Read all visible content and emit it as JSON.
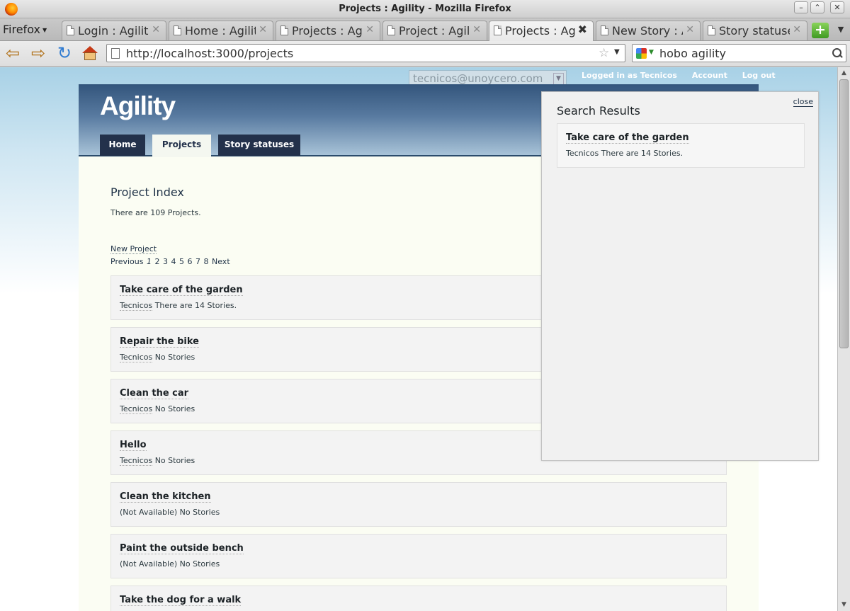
{
  "window": {
    "title": "Projects : Agility - Mozilla Firefox",
    "minimize": "–",
    "maximize": "⌃",
    "close": "✕"
  },
  "browser": {
    "menu_label": "Firefox",
    "tabs": [
      {
        "label": "Login : Agility"
      },
      {
        "label": "Home : Agility"
      },
      {
        "label": "Projects : Agility"
      },
      {
        "label": "Project : Agility"
      },
      {
        "label": "Projects : Agility"
      },
      {
        "label": "New Story : Agility"
      },
      {
        "label": "Story statuses : Agility"
      }
    ],
    "active_tab_index": 4,
    "url": "http://localhost:3000/projects",
    "search_query": "hobo agility",
    "search_engine_icon": "google-icon"
  },
  "site": {
    "user_select_value": "tecnicos@unoycero.com",
    "logged_in_text": "Logged in as Tecnicos",
    "account_link": "Account",
    "logout_link": "Log out",
    "app_name": "Agility",
    "nav": [
      {
        "label": "Home"
      },
      {
        "label": "Projects"
      },
      {
        "label": "Story statuses"
      }
    ],
    "current_nav_index": 1
  },
  "main": {
    "page_title": "Project Index",
    "count_text": "There are 109 Projects.",
    "new_link": "New Project",
    "pagination": {
      "previous": "Previous",
      "pages": [
        "1",
        "2",
        "3",
        "4",
        "5",
        "6",
        "7",
        "8"
      ],
      "current_page": "1",
      "next": "Next"
    },
    "projects": [
      {
        "name": "Take care of the garden",
        "owner": "Tecnicos",
        "stories": "There are 14 Stories."
      },
      {
        "name": "Repair the bike",
        "owner": "Tecnicos",
        "stories": "No Stories"
      },
      {
        "name": "Clean the car",
        "owner": "Tecnicos",
        "stories": "No Stories"
      },
      {
        "name": "Hello",
        "owner": "Tecnicos",
        "stories": "No Stories"
      },
      {
        "name": "Clean the kitchen",
        "owner": "(Not Available)",
        "stories": "No Stories"
      },
      {
        "name": "Paint the outside bench",
        "owner": "(Not Available)",
        "stories": "No Stories"
      },
      {
        "name": "Take the dog for a walk",
        "owner": "",
        "stories": ""
      }
    ]
  },
  "search_results": {
    "title": "Search Results",
    "close_label": "close",
    "results": [
      {
        "name": "Take care of the garden",
        "owner": "Tecnicos",
        "stories": "There are 14 Stories."
      }
    ]
  },
  "colors": {
    "header_dark": "#33557c",
    "nav_tab": "#23314b",
    "page_bg": "#fbfdf3",
    "card_bg": "#f3f3f3"
  }
}
